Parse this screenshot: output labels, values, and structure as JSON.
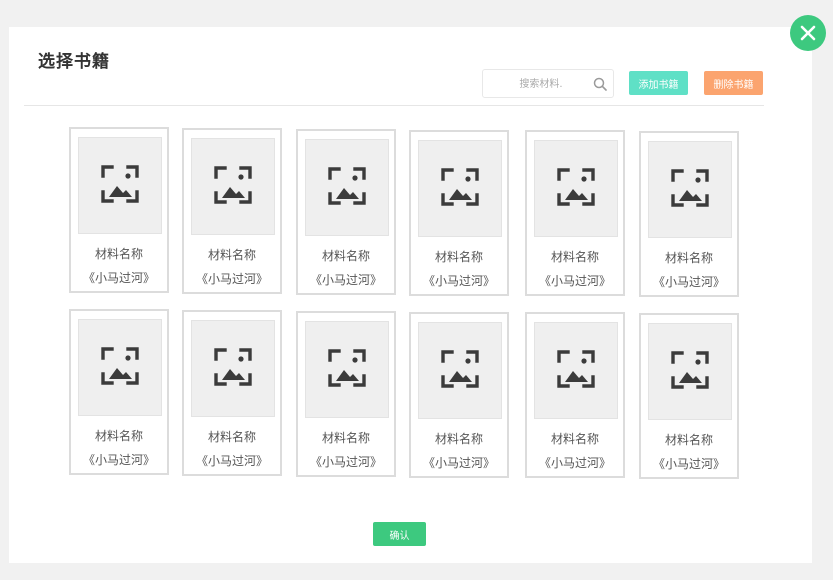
{
  "dialog": {
    "title": "选择书籍",
    "search_placeholder": "搜索材料.",
    "add_label": "添加书籍",
    "delete_label": "删除书籍",
    "confirm_label": "确认"
  },
  "colors": {
    "accent_green": "#3dc97f",
    "add_button": "#5fe0c6",
    "delete_button": "#fba46f"
  },
  "icons": {
    "close": "close-icon",
    "search": "search-icon",
    "placeholder": "image-placeholder-icon"
  },
  "books": [
    {
      "name": "材料名称",
      "subtitle": "《小马过河》"
    },
    {
      "name": "材料名称",
      "subtitle": "《小马过河》"
    },
    {
      "name": "材料名称",
      "subtitle": "《小马过河》"
    },
    {
      "name": "材料名称",
      "subtitle": "《小马过河》"
    },
    {
      "name": "材料名称",
      "subtitle": "《小马过河》"
    },
    {
      "name": "材料名称",
      "subtitle": "《小马过河》"
    },
    {
      "name": "材料名称",
      "subtitle": "《小马过河》"
    },
    {
      "name": "材料名称",
      "subtitle": "《小马过河》"
    },
    {
      "name": "材料名称",
      "subtitle": "《小马过河》"
    },
    {
      "name": "材料名称",
      "subtitle": "《小马过河》"
    },
    {
      "name": "材料名称",
      "subtitle": "《小马过河》"
    },
    {
      "name": "材料名称",
      "subtitle": "《小马过河》"
    }
  ]
}
